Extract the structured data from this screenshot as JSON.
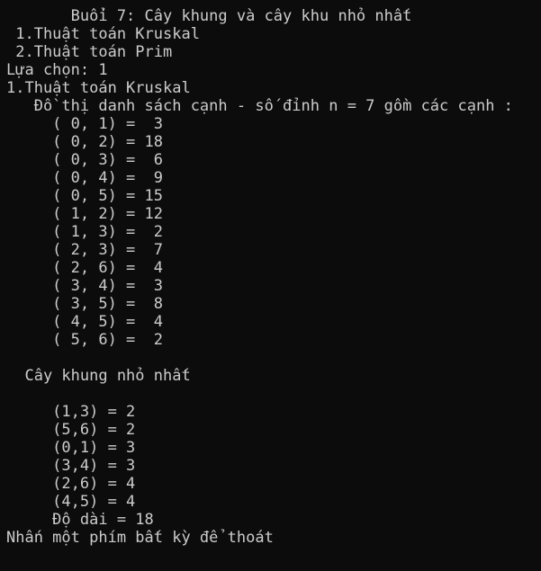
{
  "console": {
    "title": "       Buổi 7: Cây khung và cây khu nhỏ nhất",
    "menu": [
      " 1.Thuật toán Kruskal",
      " 2.Thuật toán Prim"
    ],
    "prompt": "Lựa chọn: 1",
    "selected": "1.Thuật toán Kruskal",
    "graph_header": "   Đồ thị danh sách cạnh - số đỉnh n = 7 gồm các cạnh :",
    "edges": [
      "     ( 0, 1) =  3",
      "     ( 0, 2) = 18",
      "     ( 0, 3) =  6",
      "     ( 0, 4) =  9",
      "     ( 0, 5) = 15",
      "     ( 1, 2) = 12",
      "     ( 1, 3) =  2",
      "     ( 2, 3) =  7",
      "     ( 2, 6) =  4",
      "     ( 3, 4) =  3",
      "     ( 3, 5) =  8",
      "     ( 4, 5) =  4",
      "     ( 5, 6) =  2"
    ],
    "mst_header": "  Cây khung nhỏ nhất",
    "mst_edges": [
      "     (1,3) = 2",
      "     (5,6) = 2",
      "     (0,1) = 3",
      "     (3,4) = 3",
      "     (2,6) = 4",
      "     (4,5) = 4"
    ],
    "total": "     Độ dài = 18",
    "exit_prompt": "Nhấn một phím bất kỳ để thoát"
  },
  "colors": {
    "background": "#0c0c0c",
    "text": "#cccccc"
  }
}
